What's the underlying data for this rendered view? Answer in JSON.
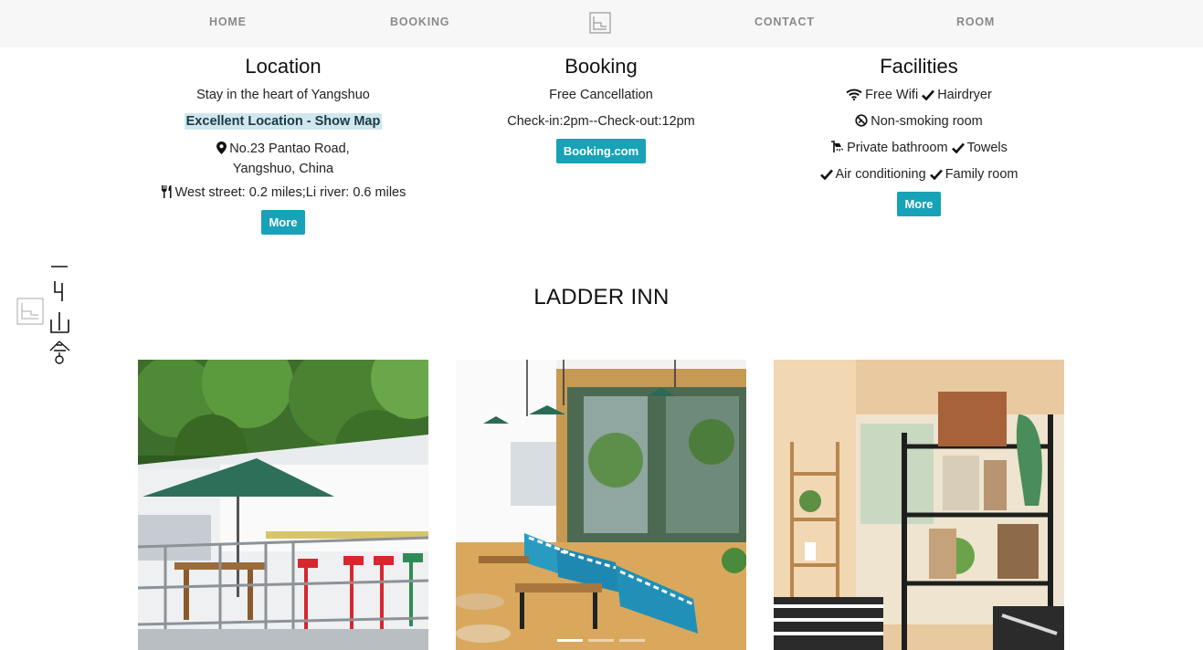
{
  "nav": {
    "items": [
      "HOME",
      "BOOKING",
      "CONTACT",
      "ROOM"
    ],
    "logo": "ladder-logo-icon"
  },
  "location": {
    "title": "Location",
    "tagline": "Stay in the heart of Yangshuo",
    "map_link": "Excellent Location - Show Map",
    "address_line1": "No.23 Pantao Road,",
    "address_line2": "Yangshuo, China",
    "distances": "West street: 0.2 miles;Li river: 0.6 miles",
    "more_label": "More"
  },
  "booking": {
    "title": "Booking",
    "cancellation": "Free Cancellation",
    "checkin": "Check-in:2pm--Check-out:12pm",
    "button_label": "Booking.com"
  },
  "facilities": {
    "title": "Facilities",
    "wifi": "Free Wifi",
    "hairdryer": "Hairdryer",
    "nonsmoking": "Non-smoking room",
    "bathroom": "Private bathroom",
    "towels": "Towels",
    "aircon": "Air conditioning",
    "family": "Family room",
    "more_label": "More"
  },
  "section": {
    "title": "LADDER INN"
  },
  "gallery": {
    "photos": [
      "terrace-photo",
      "lounge-photo",
      "shelf-photo"
    ],
    "active_dot": 0,
    "dot_count": 3
  },
  "colors": {
    "accent": "#17a2b8",
    "highlight": "#cfe8ee",
    "nav_bg": "#f7f7f7"
  }
}
